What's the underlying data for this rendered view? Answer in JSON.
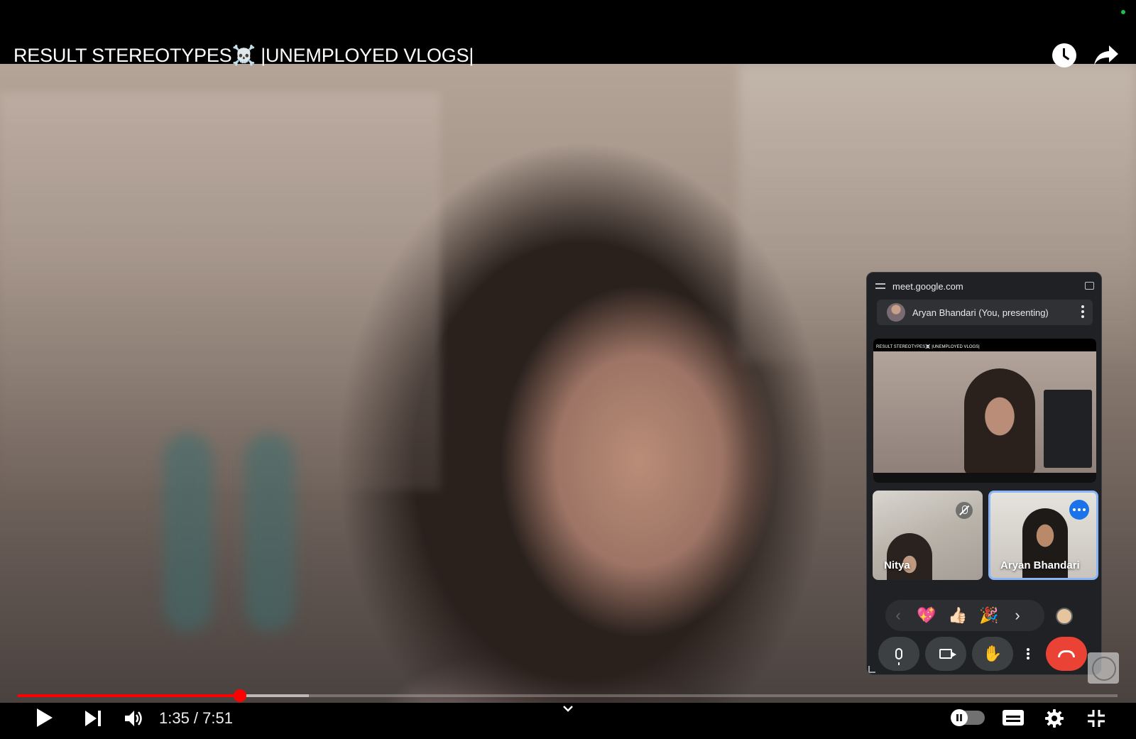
{
  "player": {
    "title": "RESULT STEREOTYPES☠️ |UNEMPLOYED VLOGS|",
    "time_current": "1:35",
    "time_total": "7:51",
    "time_display": "1:35 / 7:51",
    "progress_fraction": 0.202,
    "buffer_fraction": 0.265,
    "accent_color": "#ff0000"
  },
  "top_actions": {
    "watch_later_icon": "clock-icon",
    "share_icon": "share-arrow-icon"
  },
  "meet_pip": {
    "url": "meet.google.com",
    "presenter_label": "Aryan Bhandari (You, presenting)",
    "shared_screen_title": "RESULT STEREOTYPES☠️ |UNEMPLOYED VLOGS|",
    "participants": [
      {
        "name": "Nitya",
        "muted": true
      },
      {
        "name": "Aryan Bhandari",
        "muted": false,
        "active": true
      }
    ],
    "reactions": [
      "💖",
      "👍🏻",
      "🎉"
    ],
    "reaction_prev": "‹",
    "reaction_next": "›",
    "hand_glyph": "✋",
    "hangup_color": "#ea4335",
    "active_tile_color": "#8ab4f8"
  },
  "controls": {
    "play_icon": "play-icon",
    "next_icon": "next-icon",
    "volume_icon": "volume-icon",
    "autoplay_icon": "autoplay-toggle",
    "subtitles_icon": "subtitles-icon",
    "settings_icon": "gear-icon",
    "fullscreen_icon": "fullscreen-exit-icon"
  }
}
